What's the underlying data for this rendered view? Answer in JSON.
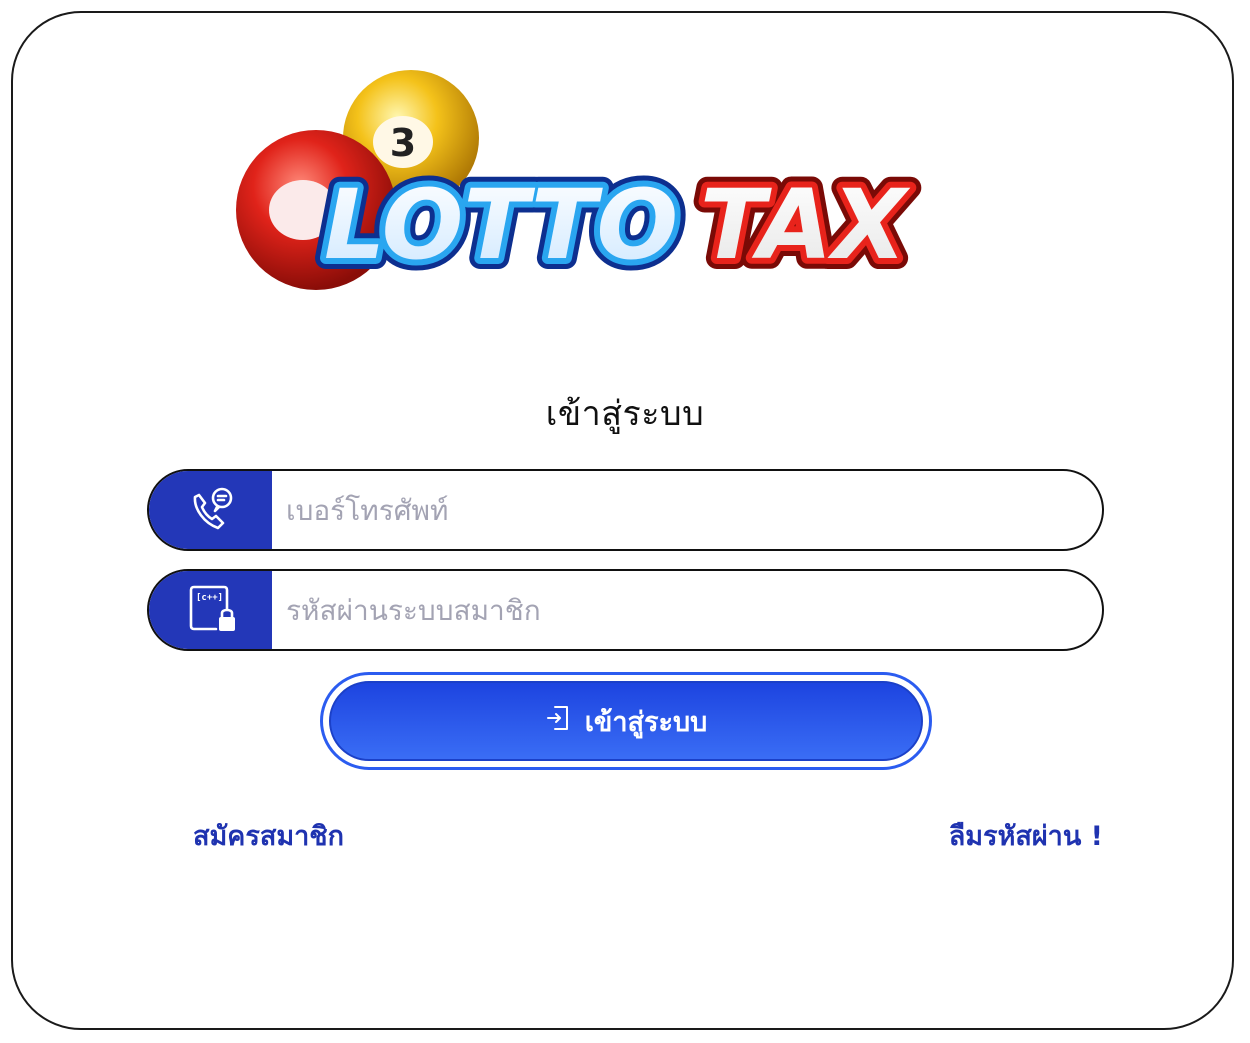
{
  "logo": {
    "text_lotto": "LOTTO",
    "text_tax": "TAX",
    "ball_number": "3"
  },
  "title": "เข้าสู่ระบบ",
  "phone_field": {
    "placeholder": "เบอร์โทรศัพท์",
    "icon": "phone-chat-icon"
  },
  "password_field": {
    "placeholder": "รหัสผ่านระบบสมาชิก",
    "icon": "code-lock-icon"
  },
  "login_button": {
    "label": "เข้าสู่ระบบ",
    "icon": "login-icon"
  },
  "links": {
    "register": "สมัครสมาชิก",
    "forgot": "ลืมรหัสผ่าน !"
  },
  "colors": {
    "primary": "#2337b8",
    "button_gradient_top": "#1d44e0",
    "button_gradient_bottom": "#3a6df5",
    "link": "#1f33b0"
  }
}
